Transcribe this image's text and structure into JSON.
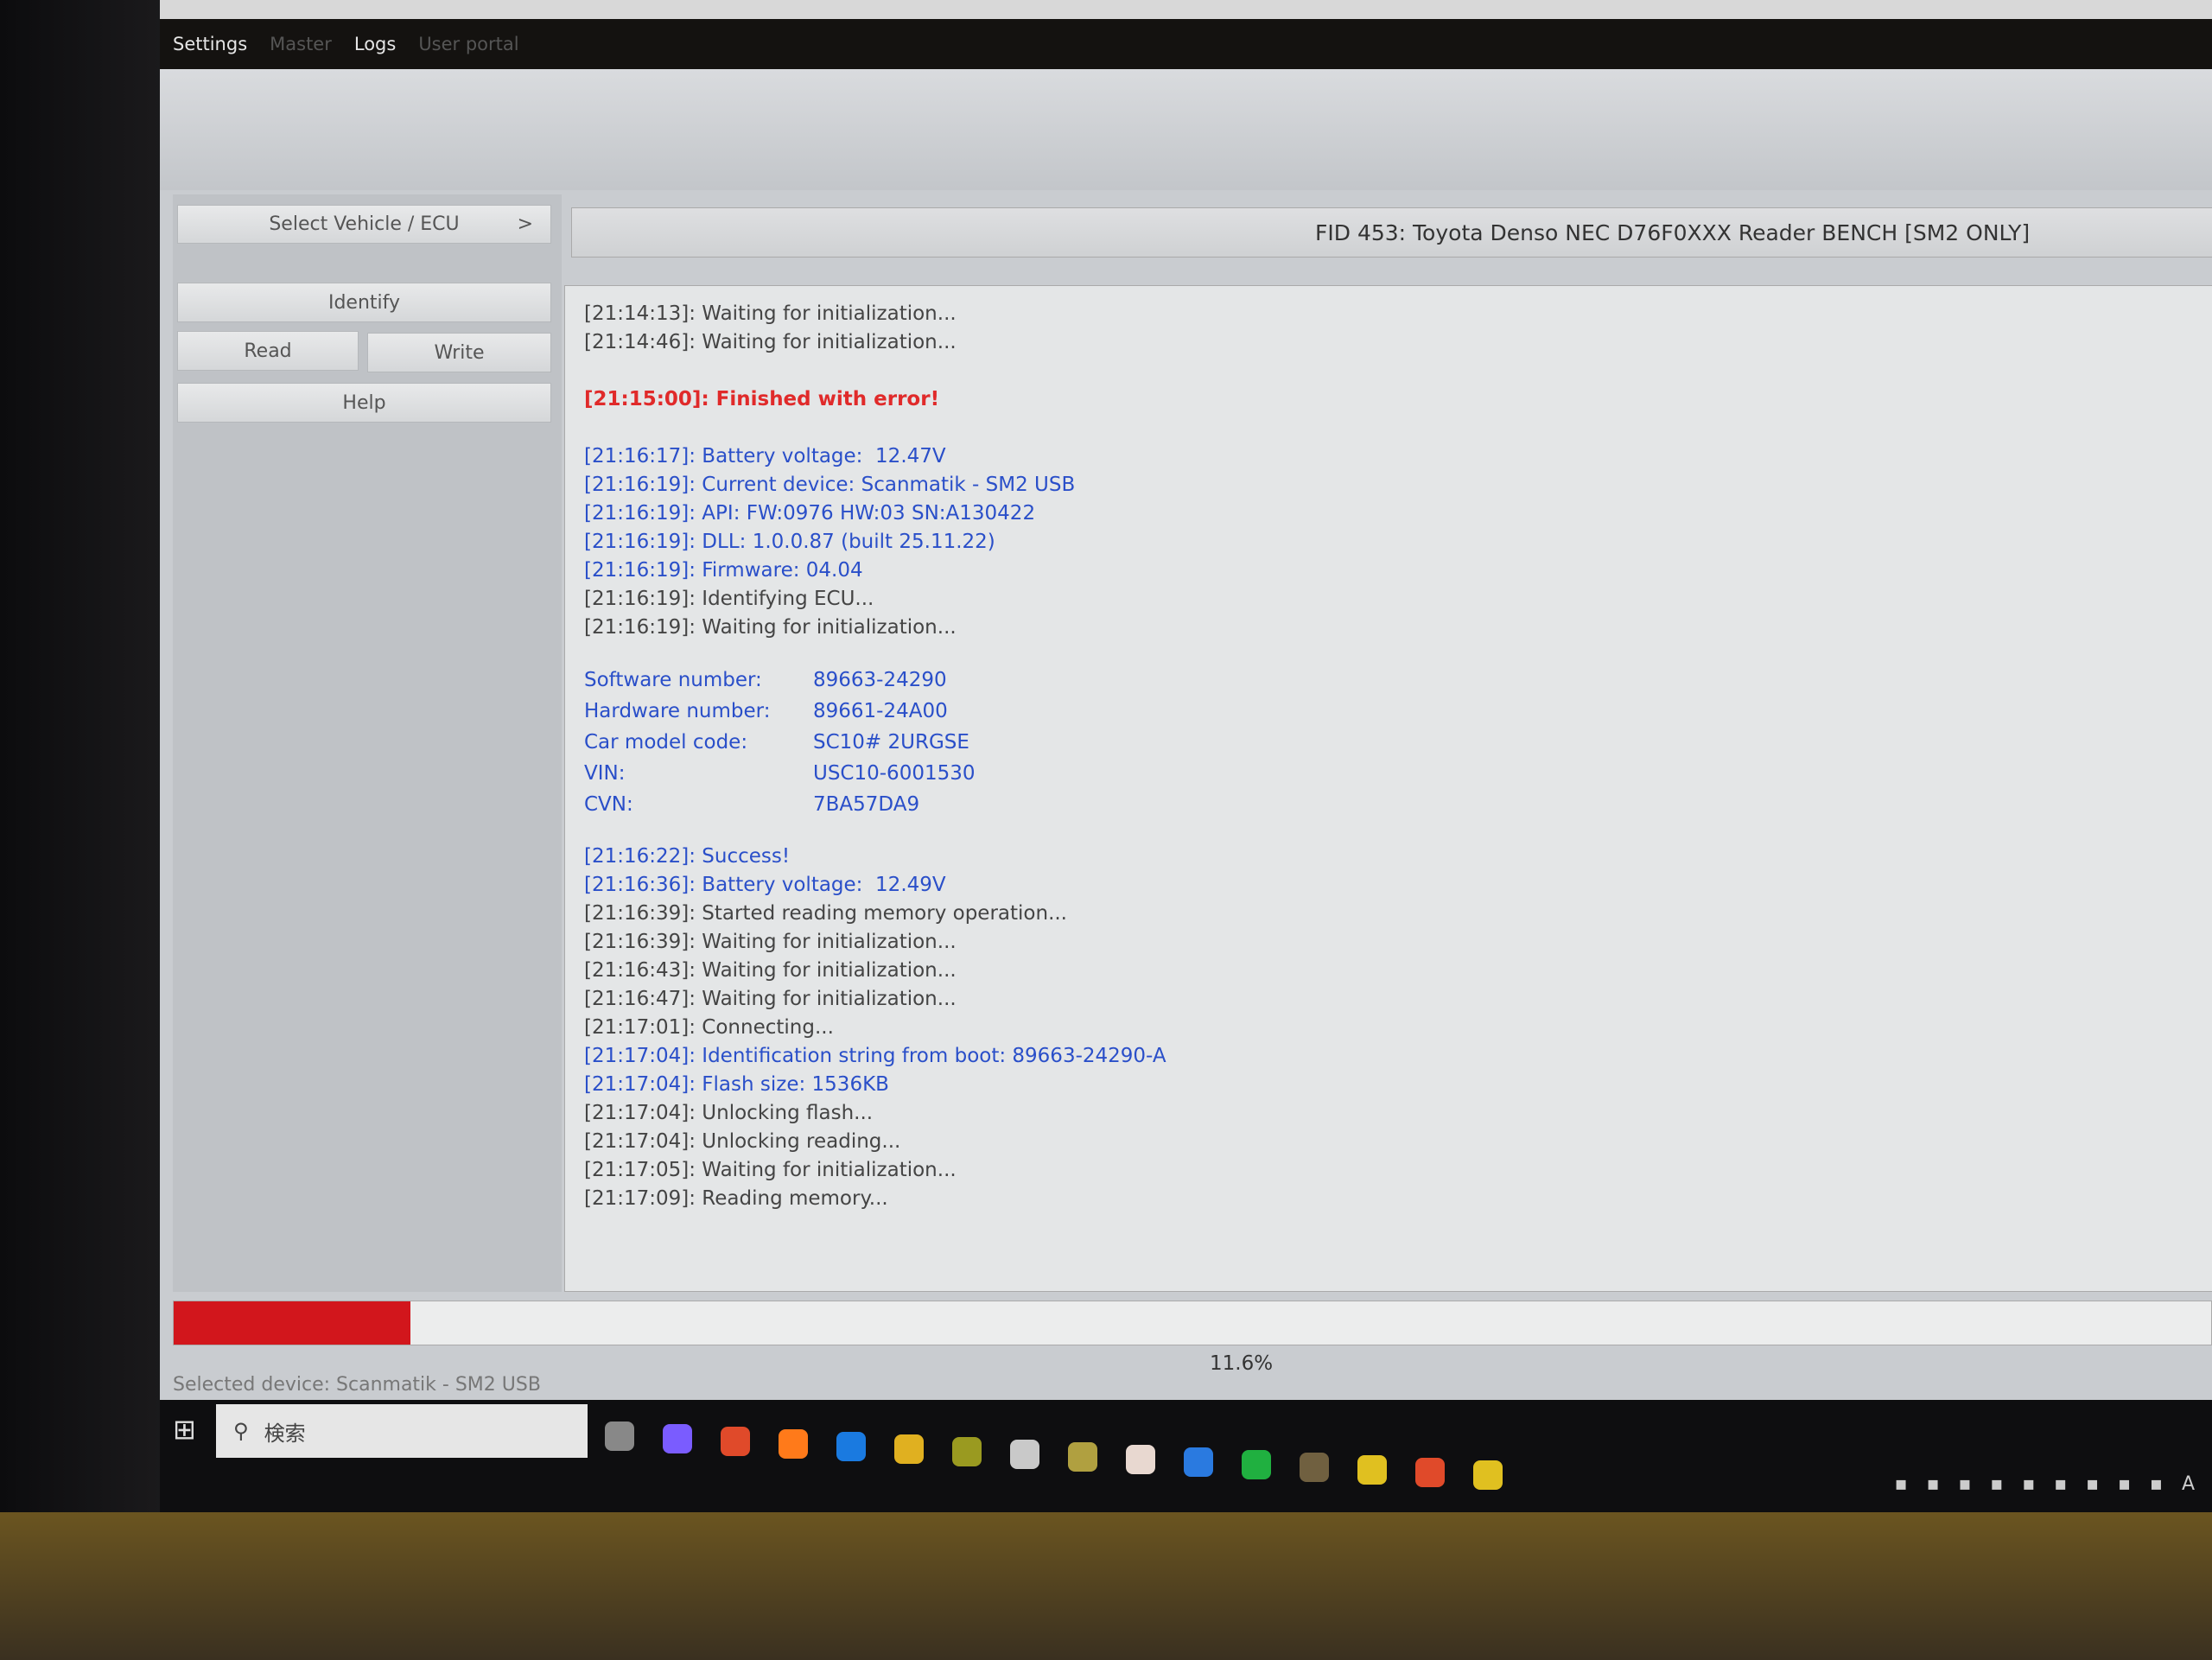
{
  "menu": {
    "items": [
      {
        "label": "Settings",
        "enabled": true
      },
      {
        "label": "Master",
        "enabled": false
      },
      {
        "label": "Logs",
        "enabled": true
      },
      {
        "label": "User portal",
        "enabled": false
      }
    ]
  },
  "left_panel": {
    "select_vehicle": "Select Vehicle / ECU",
    "select_chevron": ">",
    "identify": "Identify",
    "read": "Read",
    "write": "Write",
    "help": "Help"
  },
  "fid_title": "FID 453: Toyota Denso NEC D76F0XXX Reader BENCH [SM2 ONLY]",
  "log": [
    {
      "t": "[21:14:13]: Waiting for initialization...",
      "c": "gray"
    },
    {
      "t": "[21:14:46]: Waiting for initialization...",
      "c": "gray"
    },
    {
      "t": "",
      "c": "gray"
    },
    {
      "t": "[21:15:00]: Finished with error!",
      "c": "red"
    },
    {
      "t": "",
      "c": "gray"
    },
    {
      "t": "[21:16:17]: Battery voltage:  12.47V",
      "c": "blue"
    },
    {
      "t": "[21:16:19]: Current device: Scanmatik - SM2 USB",
      "c": "blue"
    },
    {
      "t": "[21:16:19]: API: FW:0976 HW:03 SN:A130422",
      "c": "blue"
    },
    {
      "t": "[21:16:19]: DLL: 1.0.0.87 (built 25.11.22)",
      "c": "blue"
    },
    {
      "t": "[21:16:19]: Firmware: 04.04",
      "c": "blue"
    },
    {
      "t": "[21:16:19]: Identifying ECU...",
      "c": "gray"
    },
    {
      "t": "[21:16:19]: Waiting for initialization...",
      "c": "gray"
    }
  ],
  "ecu_info": [
    {
      "k": "Software number:",
      "v": "89663-24290"
    },
    {
      "k": "Hardware number:",
      "v": "89661-24A00"
    },
    {
      "k": "Car model code:",
      "v": "SC10# 2URGSE"
    },
    {
      "k": "VIN:",
      "v": "USC10-6001530"
    },
    {
      "k": "CVN:",
      "v": "7BA57DA9"
    }
  ],
  "log2": [
    {
      "t": "[21:16:22]: Success!",
      "c": "blue"
    },
    {
      "t": "[21:16:36]: Battery voltage:  12.49V",
      "c": "blue"
    },
    {
      "t": "[21:16:39]: Started reading memory operation...",
      "c": "gray"
    },
    {
      "t": "[21:16:39]: Waiting for initialization...",
      "c": "gray"
    },
    {
      "t": "[21:16:43]: Waiting for initialization...",
      "c": "gray"
    },
    {
      "t": "[21:16:47]: Waiting for initialization...",
      "c": "gray"
    },
    {
      "t": "[21:17:01]: Connecting...",
      "c": "gray"
    },
    {
      "t": "[21:17:04]: Identification string from boot: 89663-24290-A",
      "c": "blue"
    },
    {
      "t": "[21:17:04]: Flash size: 1536KB",
      "c": "blue"
    },
    {
      "t": "[21:17:04]: Unlocking flash...",
      "c": "gray"
    },
    {
      "t": "[21:17:04]: Unlocking reading...",
      "c": "gray"
    },
    {
      "t": "[21:17:05]: Waiting for initialization...",
      "c": "gray"
    },
    {
      "t": "[21:17:09]: Reading memory...",
      "c": "gray"
    }
  ],
  "progress": {
    "percent": 11.6,
    "label": "11.6%",
    "color": "#d2161c"
  },
  "status": "Selected device: Scanmatik - SM2 USB",
  "taskbar": {
    "search_placeholder": "検索",
    "icons": [
      "task-view",
      "copilot",
      "chrome",
      "firefox",
      "edge-blue",
      "file-explorer",
      "app-green",
      "app-media",
      "app-hex",
      "app-tool",
      "app-blue",
      "whatsapp",
      "app-ms",
      "app-yellow",
      "chrome-2",
      "app-yellow-2"
    ],
    "tray": [
      "signal",
      "teamviewer",
      "battery",
      "onedrive",
      "app-tray",
      "bluetooth",
      "defender",
      "usb",
      "mute",
      "A"
    ]
  }
}
